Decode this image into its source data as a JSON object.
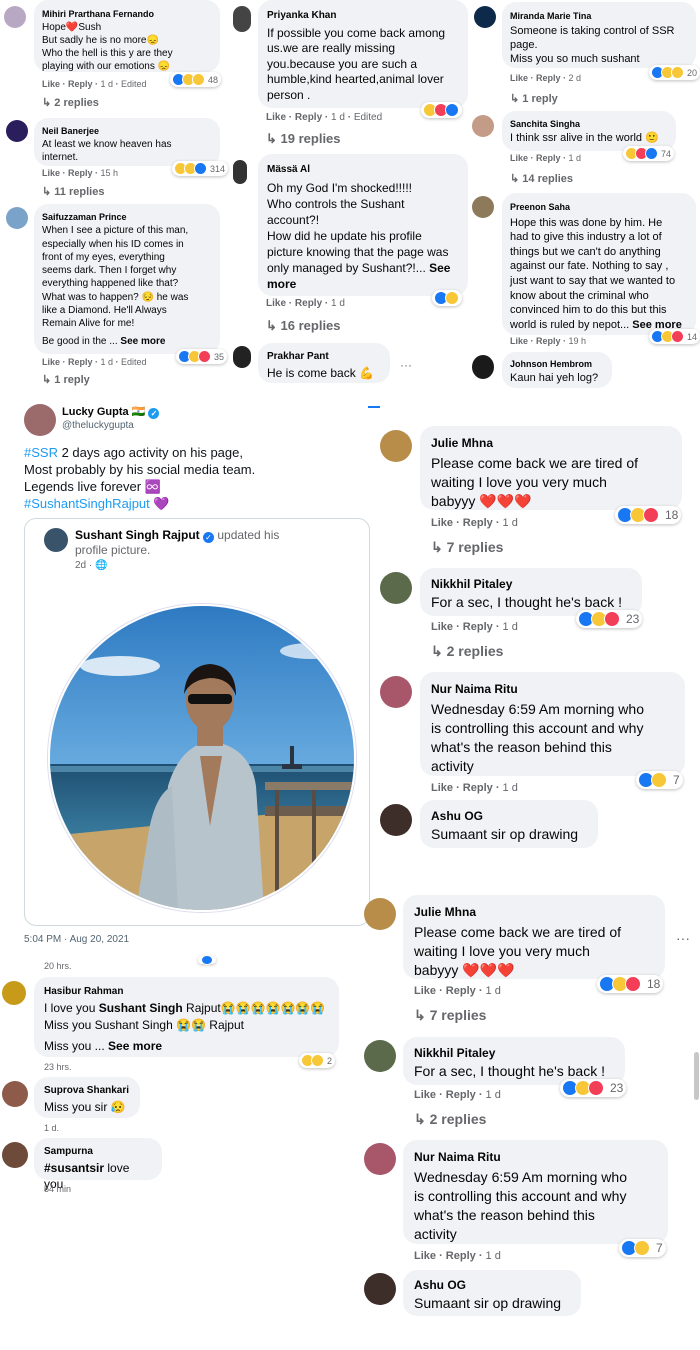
{
  "c1": {
    "c1": {
      "name": "Mihiri Prarthana Fernando",
      "lines": [
        "Hope❤️Sush",
        "But sadly he is no more😞",
        "Who the hell is this y are they",
        "playing with our emotions 😞"
      ],
      "like": "Like",
      "reply": "Reply",
      "time": "1 d",
      "edited": "Edited",
      "count": "48",
      "replies": "2 replies"
    },
    "c2": {
      "name": "Neil Banerjee",
      "lines": [
        "At least we know heaven has",
        "internet."
      ],
      "like": "Like",
      "reply": "Reply",
      "time": "15 h",
      "count": "314",
      "replies": "11 replies"
    },
    "c3": {
      "name": "Saifuzzaman Prince",
      "lines": [
        "When I see a picture of this man,",
        "especially when his ID comes in",
        "front of my eyes, everything",
        "seems dark. Then I forget why",
        "everything happened like that?",
        "What was to happen? 😔 he was",
        "like a Diamond. He'll Always",
        "Remain Alive for me!"
      ],
      "last": "Be good in the ...",
      "see_more": "See more",
      "like": "Like",
      "reply": "Reply",
      "time": "1 d",
      "edited": "Edited",
      "count": "35",
      "replies": "1 reply"
    }
  },
  "c2": {
    "p1": {
      "name": "Priyanka Khan",
      "lines": [
        "If possible you come back among",
        "us.we are really missing",
        "you.because you are such a",
        "humble,kind hearted,animal lover",
        "person ."
      ],
      "like": "Like",
      "reply": "Reply",
      "time": "1 d",
      "edited": "Edited",
      "replies": "19 replies"
    },
    "p2": {
      "name": "Mässä Al",
      "lines": [
        "Oh my God I'm shocked!!!!!",
        "Who controls the Sushant",
        "account?!",
        "How did he update his profile",
        "picture knowing that the page was",
        "only managed by Sushant?!..."
      ],
      "see_more": "See more",
      "like": "Like",
      "reply": "Reply",
      "time": "1 d",
      "replies": "16 replies"
    },
    "p3": {
      "name": "Prakhar Pant",
      "text": "He is come back 💪",
      "more": "···"
    }
  },
  "c3": {
    "m1": {
      "name": "Miranda Marie Tina",
      "lines": [
        "Someone is taking control of SSR",
        "page.",
        "Miss you so much sushant"
      ],
      "like": "Like",
      "reply": "Reply",
      "time": "2 d",
      "count": "20",
      "replies": "1 reply"
    },
    "m2": {
      "name": "Sanchita Singha",
      "text": "I think ssr alive in the world 🙂",
      "like": "Like",
      "reply": "Reply",
      "time": "1 d",
      "count": "74",
      "replies": "14 replies"
    },
    "m3": {
      "name": "Preenon Saha",
      "lines": [
        "Hope this was done by him. He",
        "had to give this industry a lot of",
        "things but we can't do anything",
        "against our fate. Nothing to say ,",
        "just want to say that we wanted to",
        "know about the criminal who",
        "convinced him to do this but this",
        "world is ruled by nepot..."
      ],
      "see_more": "See more",
      "like": "Like",
      "reply": "Reply",
      "time": "19 h",
      "count": "14"
    },
    "m4": {
      "name": "Johnson Hembrom",
      "text": "Kaun hai yeh log?"
    }
  },
  "tweet": {
    "name": "Lucky Gupta 🇮🇳",
    "handle": "@theluckygupta",
    "text1_tag": "#SSR",
    "text1": " 2 days ago activity on his page,",
    "text2": "Most probably by his social media team.",
    "text3": "Legends live forever ♾️",
    "tag2": "#SushantSinghRajput 💜",
    "card_name": "Sushant Singh Rajput",
    "card_action": " updated his",
    "card_action2": "profile picture.",
    "card_time": "2d · 🌐",
    "timestamp": "5:04 PM · Aug 20, 2021"
  },
  "lower_left": {
    "t1": "20 hrs.",
    "h1": {
      "name": "Hasibur Rahman",
      "pre": "I love you ",
      "bold": "Sushant Singh",
      "post": " Rajput😭😭😭😭😭😭😭",
      "line2": "Miss you Sushant Singh 😭😭 Rajput",
      "line3": "Miss you ...",
      "see_more": "See more",
      "count": "2"
    },
    "t2": "23 hrs.",
    "h2": {
      "name": "Suprova Shankari",
      "text": "Miss you sir 😥"
    },
    "t3": "1 d.",
    "h3": {
      "name": "Sampurna",
      "bold": "#susantsir",
      "text": " love you"
    },
    "t4": "54 min"
  },
  "right_a": {
    "j": {
      "name": "Julie Mhna",
      "lines": [
        "Please come back we are tired of",
        "waiting I love you very much",
        "babyyy ❤️❤️❤️"
      ],
      "like": "Like",
      "reply": "Reply",
      "time": "1 d",
      "count": "18",
      "replies": "7 replies"
    },
    "n": {
      "name": "Nikkhil Pitaley",
      "text": "For a sec, I thought he's back !",
      "like": "Like",
      "reply": "Reply",
      "time": "1 d",
      "count": "23",
      "replies": "2 replies"
    },
    "r": {
      "name": "Nur Naima Ritu",
      "lines": [
        "Wednesday 6:59 Am morning who",
        "is controlling this account and why",
        "what's the reason behind this",
        "activity"
      ],
      "like": "Like",
      "reply": "Reply",
      "time": "1 d",
      "count": "7"
    },
    "a": {
      "name": "Ashu OG",
      "text": "Sumaant sir op drawing"
    }
  },
  "right_b": {
    "j": {
      "name": "Julie Mhna",
      "lines": [
        "Please come back we are tired of",
        "waiting I love you very much",
        "babyyy ❤️❤️❤️"
      ],
      "like": "Like",
      "reply": "Reply",
      "time": "1 d",
      "count": "18",
      "replies": "7 replies",
      "more": "···"
    },
    "n": {
      "name": "Nikkhil Pitaley",
      "text": "For a sec, I thought he's back !",
      "like": "Like",
      "reply": "Reply",
      "time": "1 d",
      "count": "23",
      "replies": "2 replies"
    },
    "r": {
      "name": "Nur Naima Ritu",
      "lines": [
        "Wednesday 6:59 Am morning who",
        "is controlling this account and why",
        "what's the reason behind this",
        "activity"
      ],
      "like": "Like",
      "reply": "Reply",
      "time": "1 d",
      "count": "7"
    },
    "a": {
      "name": "Ashu OG",
      "text": "Sumaant sir op drawing"
    }
  },
  "icons": {
    "reply_arrow": "↳",
    "globe": "globe-icon",
    "verified": "verified-icon"
  },
  "colors": {
    "bubble": "#f0f2f5",
    "meta": "#65676b",
    "link": "#1d9bf0",
    "like_blue": "#1877f2",
    "love_red": "#f33e58",
    "haha_yellow": "#f7c737"
  }
}
